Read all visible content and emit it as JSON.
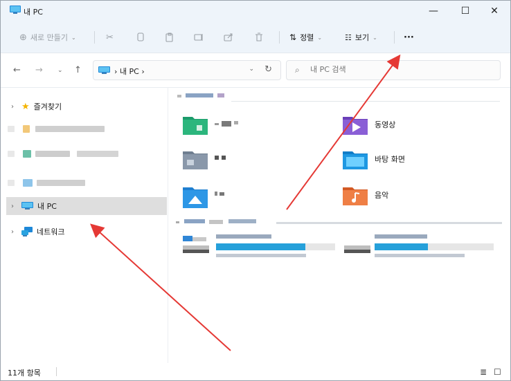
{
  "window": {
    "title": "내 PC",
    "minimize": "—",
    "maximize": "☐",
    "close": "✕"
  },
  "toolbar": {
    "new_label": "새로 만들기",
    "sort_label": "정렬",
    "view_label": "보기",
    "more_label": "···"
  },
  "address": {
    "path": "› 내 PC ›",
    "search_placeholder": "내 PC 검색"
  },
  "sidebar": {
    "favorites": "즐겨찾기",
    "this_pc": "내 PC",
    "network": "네트워크"
  },
  "folders": [
    {
      "name": "동영상",
      "color": "#7b4ec9"
    },
    {
      "name": "바탕 화면",
      "color": "#1e90d6"
    },
    {
      "name": "음악",
      "color": "#e8733b"
    }
  ],
  "drives": [
    {
      "used_fraction": 0.75
    },
    {
      "used_fraction": 0.45
    }
  ],
  "status": {
    "items": "11개 항목"
  },
  "colors": {
    "accent": "#0078d4",
    "annotation": "#e53935",
    "titlebar": "#eef4fa"
  }
}
